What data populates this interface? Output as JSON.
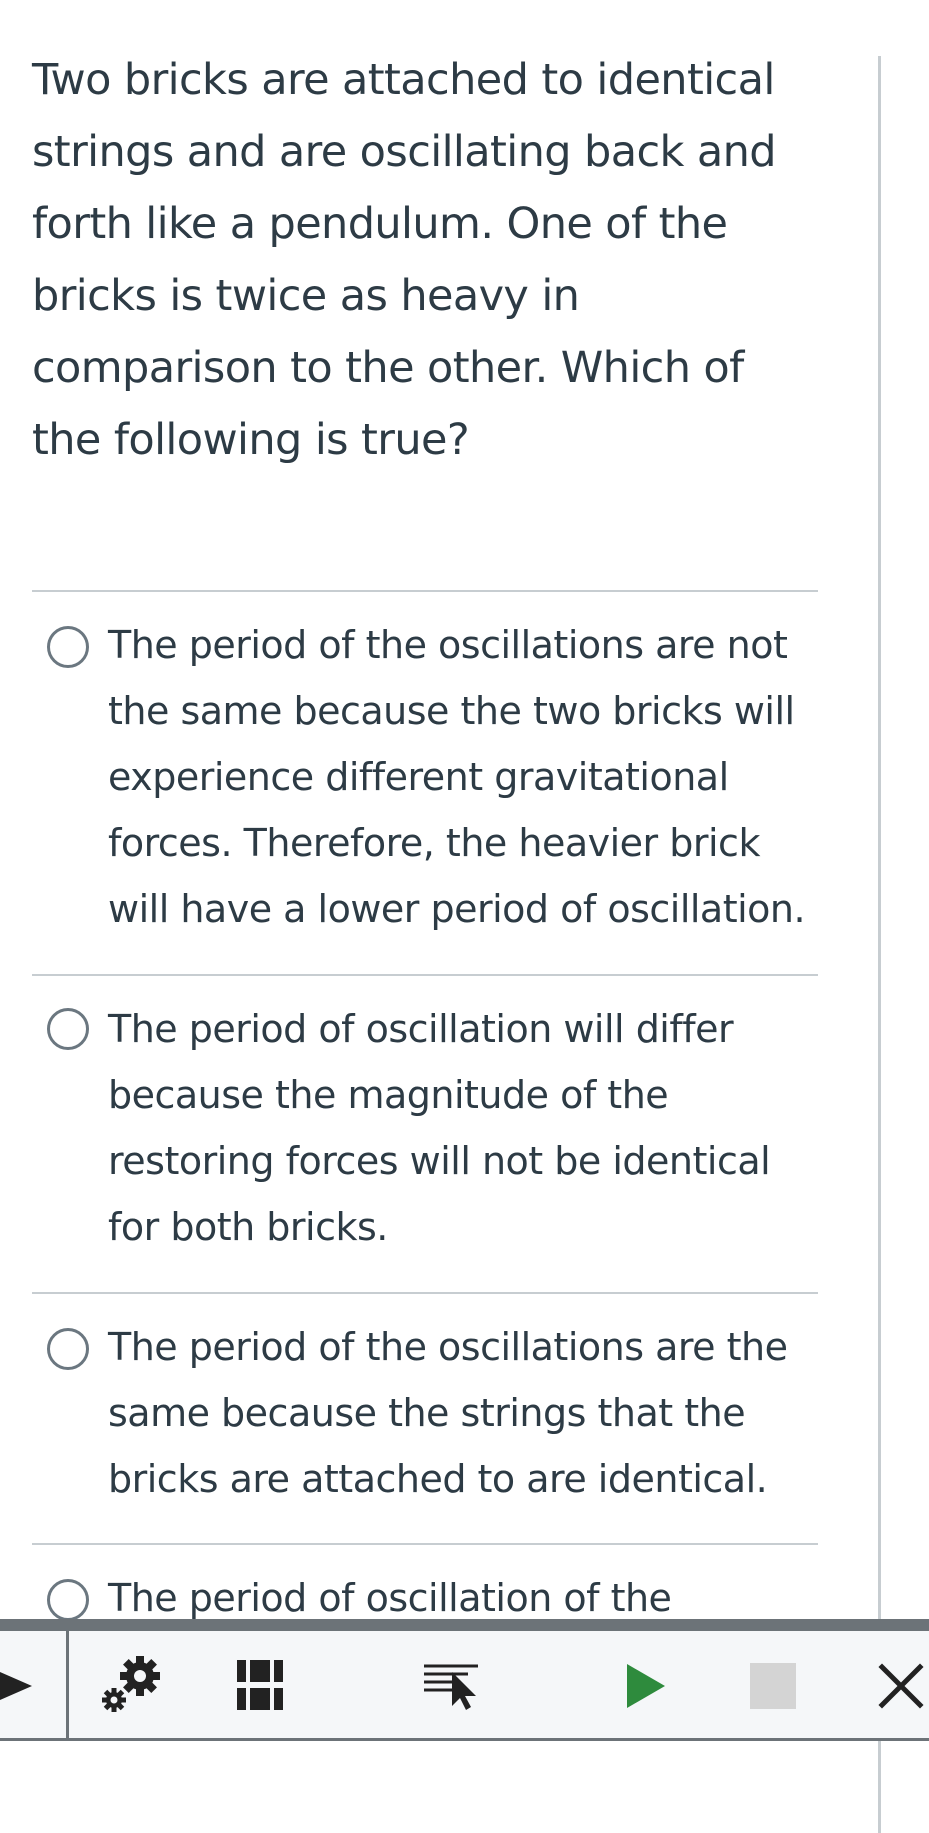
{
  "question": {
    "text": "Two bricks are attached to identical strings and are oscillating back and forth like a pendulum. One of the bricks is twice as heavy in comparison to the other. Which of the following is true?"
  },
  "answers": [
    {
      "text": "The period of the oscillations are not the same because the two bricks will experience different gravitational forces. Therefore, the heavier brick will have a lower period of oscillation.",
      "selected": false
    },
    {
      "text": "The period of oscillation will differ because the magnitude of the restoring forces will not be identical for both bricks.",
      "selected": false
    },
    {
      "text": "The period of the oscillations are the same because the strings that the bricks are attached to are identical.",
      "selected": false
    },
    {
      "text": "The period of oscillation of the",
      "selected": false
    }
  ],
  "toolbar": {
    "icons": [
      "play-arrow-icon",
      "settings-gears-icon",
      "pause-icon",
      "select-text-icon",
      "play-icon",
      "stop-icon",
      "close-icon"
    ],
    "colors": {
      "play": "#2e8b3d",
      "stop": "#d4d4d4",
      "dark": "#222222"
    }
  }
}
